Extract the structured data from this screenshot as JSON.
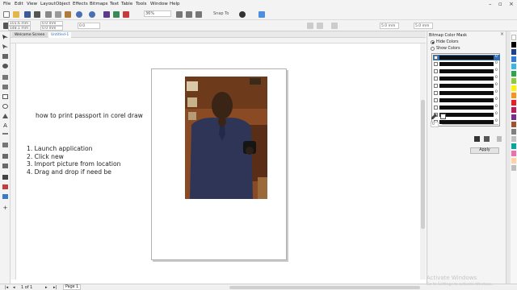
{
  "menu": [
    "File",
    "Edit",
    "View",
    "Layout",
    "Object",
    "Effects",
    "Bitmaps",
    "Text",
    "Table",
    "Tools",
    "Window",
    "Help"
  ],
  "toolbar": {
    "zoom_value": "36%",
    "snap_to": "Snap To",
    "nudge": "5.0 mm",
    "dup_distance": "5.0 mm",
    "units_value": "0.0"
  },
  "property_bar": {
    "width": "101.6 mm",
    "height": "148.1 mm",
    "pos_x": "0.0 mm",
    "pos_y": "0.0 mm"
  },
  "tabs": {
    "welcome": "Welcome Screen",
    "doc": "Untitled-1"
  },
  "canvas": {
    "title": "how to print passport in corel draw",
    "steps": [
      "1. Launch application",
      "2. Click new",
      "3. Import picture from location",
      "4. Drag and drop if need be"
    ]
  },
  "docker": {
    "title": "Bitmap Color Mask",
    "hide_colors": "Hide Colors",
    "show_colors": "Show Colors",
    "tolerance_label": "0",
    "apply": "Apply",
    "color_rows": [
      "0",
      "0",
      "0",
      "0",
      "0",
      "0",
      "0",
      "0",
      "0",
      "0"
    ]
  },
  "status": {
    "page_tab": "Page 1",
    "page_count": "1 of 1"
  },
  "watermark": {
    "line1": "Activate Windows",
    "line2": "Go to Settings to activate Windows."
  },
  "palette_colors": [
    "#ffffff",
    "#000000",
    "#1d3f8f",
    "#2b7be0",
    "#39b6e6",
    "#2ea44f",
    "#8ccb3a",
    "#fff200",
    "#f7941d",
    "#ed1c24",
    "#c2185b",
    "#7b2d8e",
    "#a0522d",
    "#808080",
    "#c0c0c0",
    "#00a99d",
    "#f06eaa",
    "#ffd1a4",
    "#bdbdbd"
  ],
  "colors": {
    "accent": "#2f6db5",
    "mask_swatch": "#0e0e0e"
  }
}
